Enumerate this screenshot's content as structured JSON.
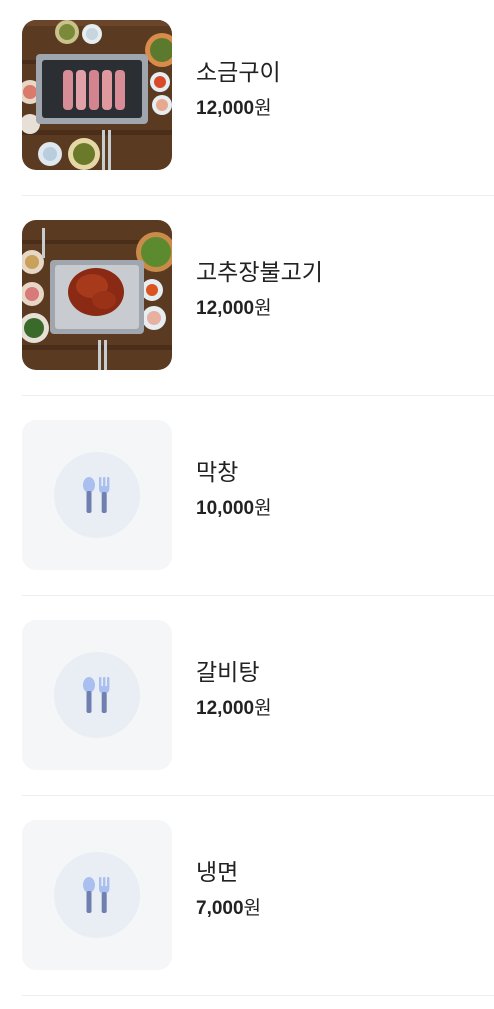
{
  "menu": {
    "items": [
      {
        "name": "소금구이",
        "price_amount": "12,000",
        "price_unit": "원",
        "photo": "grilled-pork-photo"
      },
      {
        "name": "고추장불고기",
        "price_amount": "12,000",
        "price_unit": "원",
        "photo": "spicy-bulgogi-photo"
      },
      {
        "name": "막창",
        "price_amount": "10,000",
        "price_unit": "원",
        "photo": "spoon-fork-icon"
      },
      {
        "name": "갈비탕",
        "price_amount": "12,000",
        "price_unit": "원",
        "photo": "spoon-fork-icon"
      },
      {
        "name": "냉면",
        "price_amount": "7,000",
        "price_unit": "원",
        "photo": "spoon-fork-icon"
      }
    ]
  },
  "colors": {
    "text": "#222222",
    "divider": "#eeeeee",
    "placeholder_bg": "#f5f6f8",
    "placeholder_circle": "#e9edf4",
    "icon_spoon": "#a9bff0",
    "icon_handle": "#6e7fb0"
  }
}
